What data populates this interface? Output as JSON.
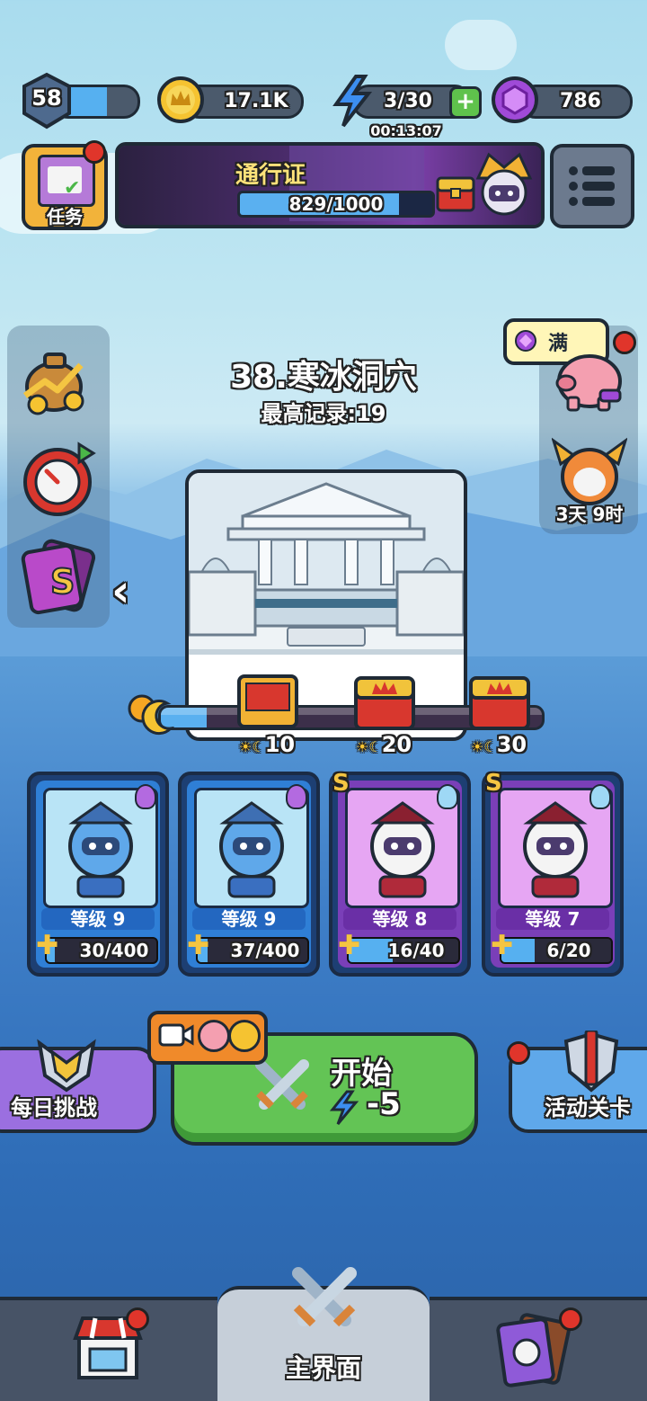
{
  "status_bar": {
    "player_level": "58",
    "gold": "17.1K",
    "energy": "3/30",
    "energy_timer": "00:13:07",
    "gems": "786"
  },
  "header": {
    "tasks_label": "任务",
    "pass_title": "通行证",
    "pass_progress": "829/1000",
    "pass_progress_fraction": 0.829
  },
  "stage": {
    "name": "38.寒冰洞穴",
    "record": "最高记录:19",
    "milestones": [
      "10",
      "20",
      "30"
    ],
    "progress_fraction": 0.12
  },
  "right_panel": {
    "piggy_bubble": "满",
    "event_timer": "3天 9时"
  },
  "heroes": [
    {
      "level": "等级 9",
      "shards": "30/400",
      "fill": 0.075,
      "rarity": "",
      "theme": "blue"
    },
    {
      "level": "等级 9",
      "shards": "37/400",
      "fill": 0.0925,
      "rarity": "",
      "theme": "blue"
    },
    {
      "level": "等级 8",
      "shards": "16/40",
      "fill": 0.4,
      "rarity": "S",
      "theme": "purple"
    },
    {
      "level": "等级 7",
      "shards": "6/20",
      "fill": 0.3,
      "rarity": "S",
      "theme": "purple"
    }
  ],
  "actions": {
    "daily_challenge": "每日挑战",
    "start_label": "开始",
    "start_cost": "-5",
    "event_stage": "活动关卡"
  },
  "bottom_nav": {
    "main_label": "主界面"
  },
  "colors": {
    "start_button": "#63c455",
    "daily_button": "#9b6fe0",
    "event_button": "#5fa8ea",
    "pass_bar": "#5ab0f0",
    "red_dot": "#e0352b"
  }
}
